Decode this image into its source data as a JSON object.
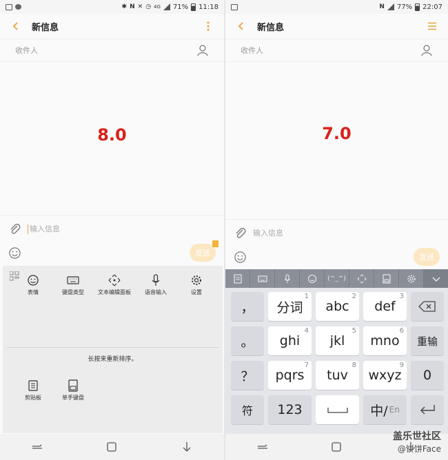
{
  "left": {
    "status": {
      "battery": "71%",
      "time": "11:18",
      "network": "4G"
    },
    "title": "新信息",
    "recipient_placeholder": "收件人",
    "version": "8.0",
    "message_placeholder": "输入信息",
    "send_label": "发送",
    "toolbar_items": [
      "表情",
      "键盘类型",
      "文本编辑面板",
      "语音输入",
      "设置"
    ],
    "toolbar_hint": "长按来重新排序。",
    "toolbar_items_lower": [
      "剪贴板",
      "单手键盘"
    ]
  },
  "right": {
    "status": {
      "battery": "77%",
      "time": "22:07"
    },
    "title": "新信息",
    "recipient_placeholder": "收件人",
    "version": "7.0",
    "message_placeholder": "输入信息",
    "send_label": "发送",
    "toolbar_emoticon": "(^_^)",
    "keys": {
      "comma": "，",
      "fenci": "分词",
      "fenci_num": "1",
      "abc": "abc",
      "abc_num": "2",
      "def": "def",
      "def_num": "3",
      "period": "。",
      "ghi": "ghi",
      "ghi_num": "4",
      "jkl": "jkl",
      "jkl_num": "5",
      "mno": "mno",
      "mno_num": "6",
      "reinput": "重输",
      "question": "？",
      "pqrs": "pqrs",
      "pqrs_num": "7",
      "tuv": "tuv",
      "tuv_num": "8",
      "wxyz": "wxyz",
      "wxyz_num": "9",
      "zero": "0",
      "symbol": "符",
      "num123": "123",
      "lang_main": "中/",
      "lang_sub": "En"
    }
  },
  "watermark": {
    "line1": "盖乐世社区",
    "line2": "@饼饼Face"
  },
  "colors": {
    "accent": "#e8a23a",
    "version": "#d9211c",
    "kb_toolbar": "#8b8f98"
  }
}
